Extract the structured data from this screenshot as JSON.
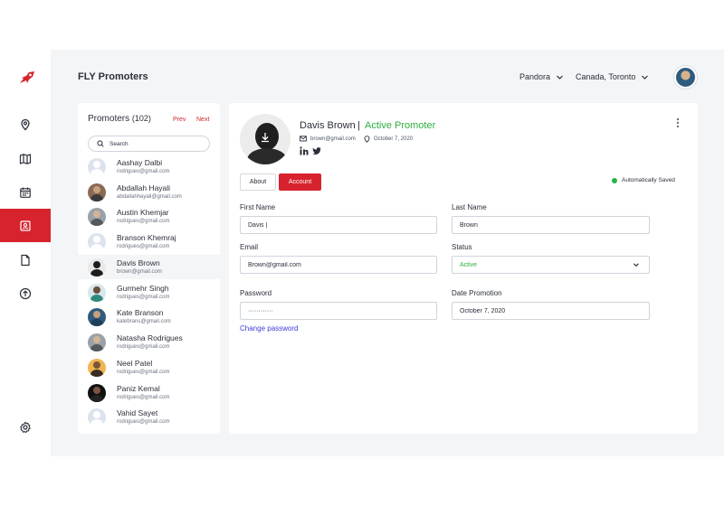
{
  "app": {
    "title": "FLY Promoters"
  },
  "header": {
    "org_dropdown": "Pandora",
    "location_dropdown": "Canada, Toronto"
  },
  "sidebar": {
    "items": [
      {
        "icon": "location-pin-icon"
      },
      {
        "icon": "map-icon"
      },
      {
        "icon": "calendar-icon"
      },
      {
        "icon": "contact-card-icon",
        "active": true
      },
      {
        "icon": "document-icon"
      },
      {
        "icon": "upload-circle-icon"
      },
      {
        "icon": "gear-icon"
      }
    ]
  },
  "promoters": {
    "title": "Promoters",
    "count": "(102)",
    "prev_label": "Prev",
    "next_label": "Next",
    "search_placeholder": "Search",
    "items": [
      {
        "name": "Aashay Dalbi",
        "email": "rodrigues@gmail.com"
      },
      {
        "name": "Abdallah Hayali",
        "email": "abdallahhayali@gmail.com"
      },
      {
        "name": "Austin Khemjar",
        "email": "rodrigues@gmail.com"
      },
      {
        "name": "Branson Khemraj",
        "email": "rodrigues@gmail.com"
      },
      {
        "name": "Davis Brown",
        "email": "brown@gmail.com"
      },
      {
        "name": "Gurmehr Singh",
        "email": "rodrigues@gmail.com"
      },
      {
        "name": "Kate Branson",
        "email": "katebrans@gmail.com"
      },
      {
        "name": "Natasha Rodrigues",
        "email": "rodrigues@gmail.com"
      },
      {
        "name": "Neel Patel",
        "email": "rodrigues@gmail.com"
      },
      {
        "name": "Paniz Kemal",
        "email": "rodrigues@gmail.com"
      },
      {
        "name": "Vahid Sayet",
        "email": "rodrigues@gmail.com"
      }
    ]
  },
  "profile": {
    "name": "Davis Brown",
    "separator": "|",
    "status_text": "Active Promoter",
    "email": "brown@gmail.com",
    "date": "October 7, 2020"
  },
  "tabs": {
    "about": "About",
    "account": "Account"
  },
  "autosave": {
    "label": "Automatically Saved"
  },
  "form": {
    "first_name_label": "First Name",
    "first_name_value": "Davis |",
    "last_name_label": "Last Name",
    "last_name_value": "Brown",
    "email_label": "Email",
    "email_value": "Brown@gmail.com",
    "status_label": "Status",
    "status_value": "Active",
    "password_label": "Password",
    "password_value": "············",
    "date_promotion_label": "Date Promotion",
    "date_promotion_value": "October 7, 2020",
    "change_password": "Change password"
  },
  "colors": {
    "accent": "#d7232e",
    "active_green": "#2eaf3f",
    "link_blue": "#3b3bd8"
  }
}
